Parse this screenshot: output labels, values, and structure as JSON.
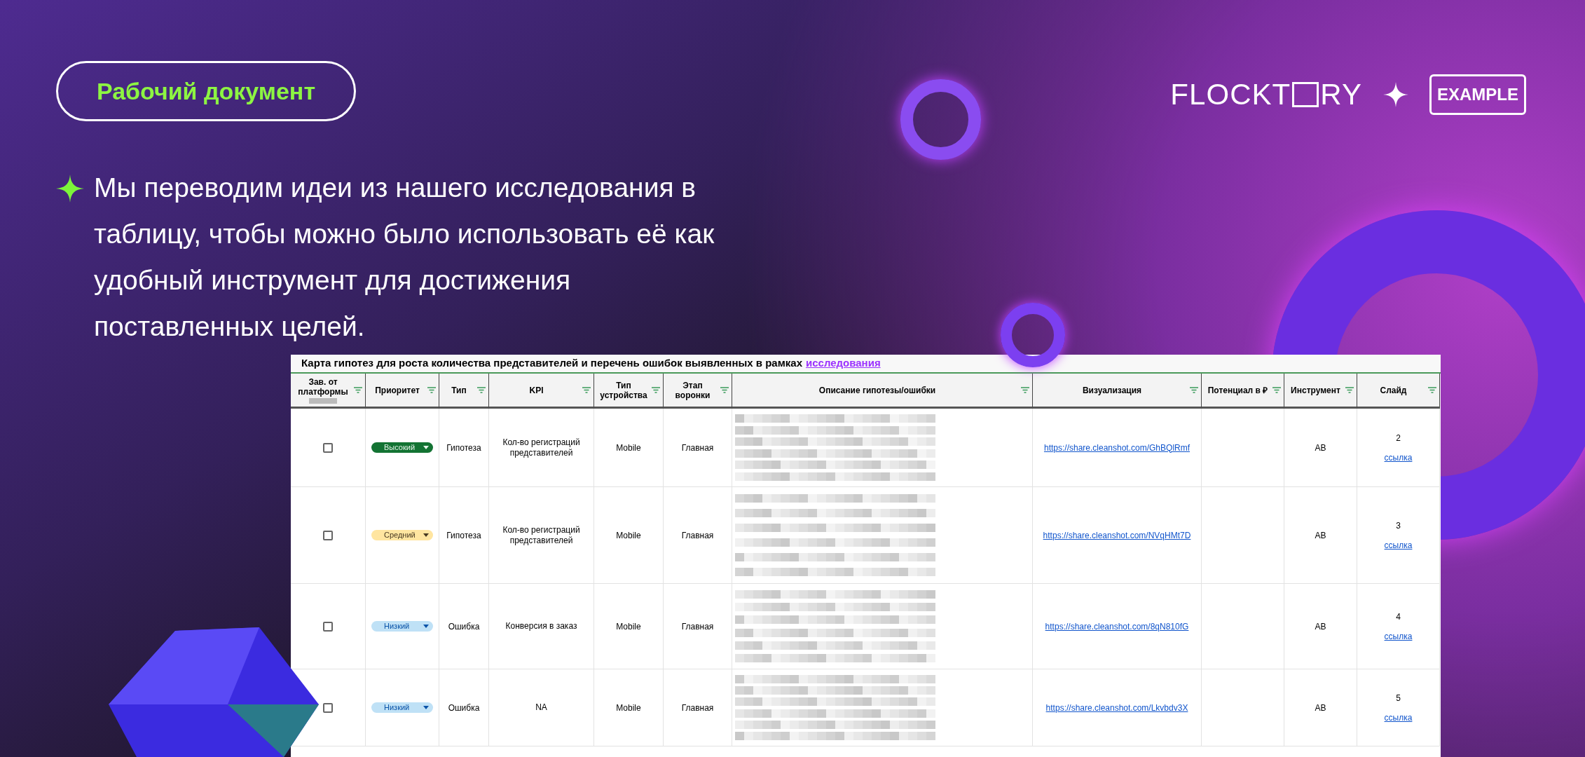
{
  "badge": {
    "label": "Рабочий документ"
  },
  "intro": {
    "text": "Мы переводим идеи из нашего исследования в таблицу, чтобы можно было использовать её как удобный инструмент для достижения поставленных целей."
  },
  "logos": {
    "brand_left": "FLOCKT",
    "brand_right": "RY",
    "partner": "EXAMPLE"
  },
  "table": {
    "title": "Карта гипотез для роста количества представителей и перечень ошибок выявленных в рамках",
    "title_link": "исследования",
    "columns": [
      "Зав. от платформы",
      "Приоритет",
      "Тип",
      "KPI",
      "Тип устройства",
      "Этап воронки",
      "Описание гипотезы/ошибки",
      "Визуализация",
      "Потенциал в ₽",
      "Инструмент",
      "Слайд"
    ],
    "rows": [
      {
        "checked": false,
        "priority": {
          "label": "Высокий",
          "kind": "high"
        },
        "type": "Гипотеза",
        "kpi": "Кол-во регистраций представителей",
        "device": "Mobile",
        "stage": "Главная",
        "visualization": "https://share.cleanshot.com/GhBQlRmf",
        "tool": "AB",
        "slide": "2",
        "slide_link": "ссылка"
      },
      {
        "checked": false,
        "priority": {
          "label": "Средний",
          "kind": "medium"
        },
        "type": "Гипотеза",
        "kpi": "Кол-во регистраций представителей",
        "device": "Mobile",
        "stage": "Главная",
        "visualization": "https://share.cleanshot.com/NVqHMt7D",
        "tool": "AB",
        "slide": "3",
        "slide_link": "ссылка"
      },
      {
        "checked": false,
        "priority": {
          "label": "Низкий",
          "kind": "low"
        },
        "type": "Ошибка",
        "kpi": "Конверсия в заказ",
        "device": "Mobile",
        "stage": "Главная",
        "visualization": "https://share.cleanshot.com/8qN810fG",
        "tool": "AB",
        "slide": "4",
        "slide_link": "ссылка"
      },
      {
        "checked": false,
        "priority": {
          "label": "Низкий",
          "kind": "low"
        },
        "type": "Ошибка",
        "kpi": "NA",
        "device": "Mobile",
        "stage": "Главная",
        "visualization": "https://share.cleanshot.com/Lkvbdv3X",
        "tool": "AB",
        "slide": "5",
        "slide_link": "ссылка"
      }
    ]
  }
}
